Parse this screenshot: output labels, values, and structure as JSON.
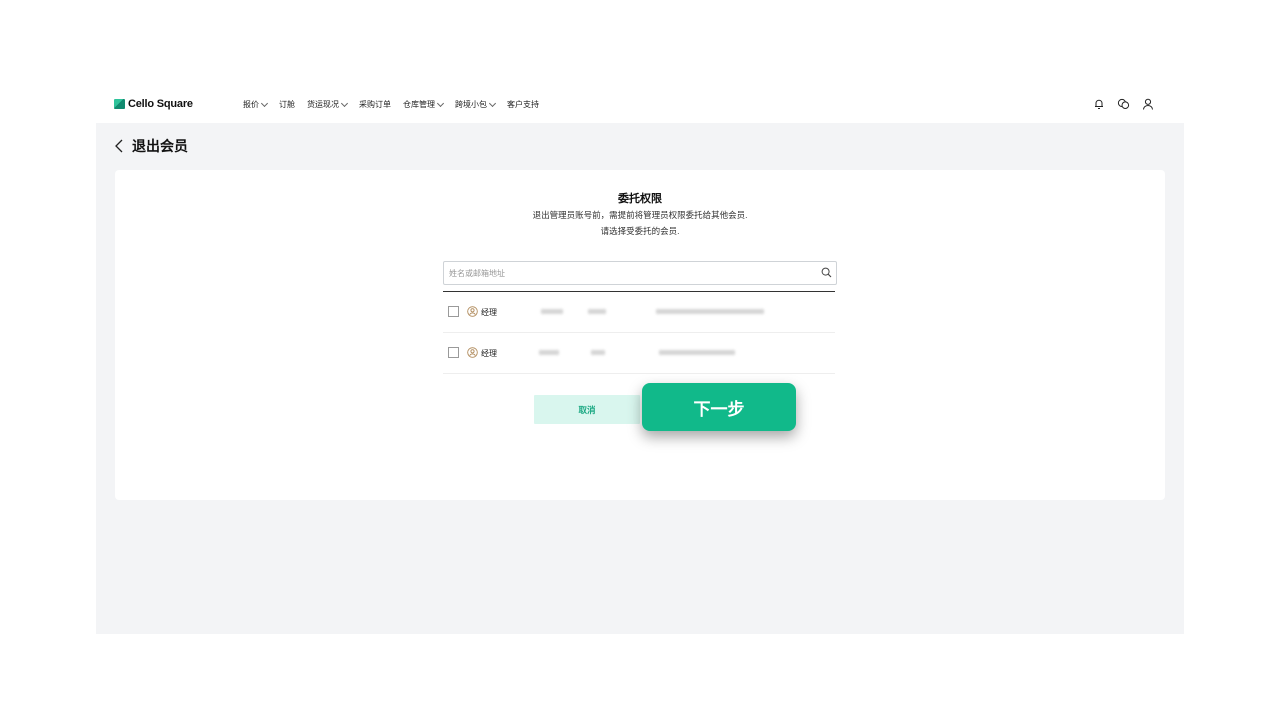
{
  "header": {
    "logo": "Cello Square",
    "nav": [
      {
        "label": "报价",
        "dropdown": true
      },
      {
        "label": "订舱",
        "dropdown": false
      },
      {
        "label": "货运现况",
        "dropdown": true
      },
      {
        "label": "采购订单",
        "dropdown": false
      },
      {
        "label": "仓库管理",
        "dropdown": true
      },
      {
        "label": "跨境小包",
        "dropdown": true
      },
      {
        "label": "客户支持",
        "dropdown": false
      }
    ],
    "icons": [
      "bell-icon",
      "chat-icon",
      "user-icon"
    ]
  },
  "page": {
    "title": "退出会员"
  },
  "dialog": {
    "title": "委托权限",
    "desc_line1": "退出管理员账号前，需提前将管理员权限委托给其他会员.",
    "desc_line2": "请选择受委托的会员.",
    "search_placeholder": "姓名或邮箱地址",
    "members": [
      {
        "role": "经理",
        "name_redacted": "██████",
        "dept_redacted": "████",
        "email_redacted": "████████████████"
      },
      {
        "role": "经理",
        "name_redacted": "████",
        "dept_redacted": "███",
        "email_redacted": "████████████"
      }
    ],
    "cancel_label": "取消",
    "next_label": "下一步"
  },
  "colors": {
    "accent": "#11b98a",
    "cancel_bg": "#d9f6ee",
    "cancel_text": "#1aa882",
    "page_bg": "#f3f4f6"
  }
}
